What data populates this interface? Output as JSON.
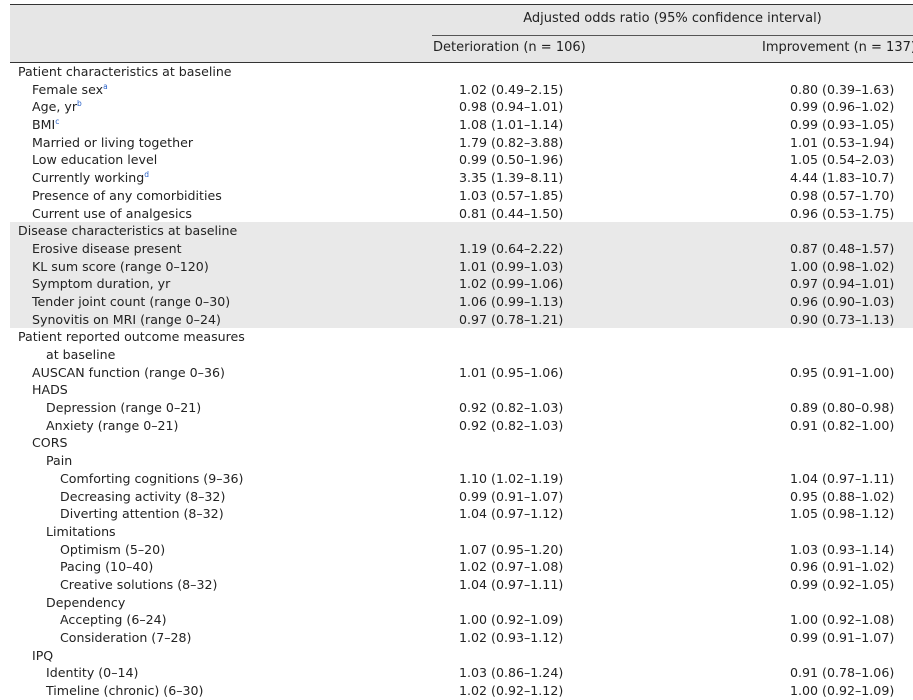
{
  "header": {
    "main": "Adjusted odds ratio (95% confidence interval)",
    "col_deterioration": "Deterioration (n = 106)",
    "col_improvement": "Improvement (n = 137)"
  },
  "rows": [
    {
      "label": "Patient characteristics at baseline",
      "sup": "",
      "d": "",
      "i": "",
      "level": 0,
      "shaded": false
    },
    {
      "label": "Female sex",
      "sup": "a",
      "d": "1.02 (0.49–2.15)",
      "i": "0.80 (0.39–1.63)",
      "level": 1,
      "shaded": false
    },
    {
      "label": "Age, yr",
      "sup": "b",
      "d": "0.98 (0.94–1.01)",
      "i": "0.99 (0.96–1.02)",
      "level": 1,
      "shaded": false
    },
    {
      "label": "BMI",
      "sup": "c",
      "d": "1.08 (1.01–1.14)",
      "i": "0.99 (0.93–1.05)",
      "level": 1,
      "shaded": false
    },
    {
      "label": "Married or living together",
      "sup": "",
      "d": "1.79 (0.82–3.88)",
      "i": "1.01 (0.53–1.94)",
      "level": 1,
      "shaded": false
    },
    {
      "label": "Low education level",
      "sup": "",
      "d": "0.99 (0.50–1.96)",
      "i": "1.05 (0.54–2.03)",
      "level": 1,
      "shaded": false
    },
    {
      "label": "Currently working",
      "sup": "d",
      "d": "3.35 (1.39–8.11)",
      "i": "4.44 (1.83–10.7)",
      "level": 1,
      "shaded": false
    },
    {
      "label": "Presence of any comorbidities",
      "sup": "",
      "d": "1.03 (0.57–1.85)",
      "i": "0.98 (0.57–1.70)",
      "level": 1,
      "shaded": false
    },
    {
      "label": "Current use of analgesics",
      "sup": "",
      "d": "0.81 (0.44–1.50)",
      "i": "0.96 (0.53–1.75)",
      "level": 1,
      "shaded": false
    },
    {
      "label": "Disease characteristics at baseline",
      "sup": "",
      "d": "",
      "i": "",
      "level": 0,
      "shaded": true
    },
    {
      "label": "Erosive disease present",
      "sup": "",
      "d": "1.19 (0.64–2.22)",
      "i": "0.87 (0.48–1.57)",
      "level": 1,
      "shaded": true
    },
    {
      "label": "KL sum score (range 0–120)",
      "sup": "",
      "d": "1.01 (0.99–1.03)",
      "i": "1.00 (0.98–1.02)",
      "level": 1,
      "shaded": true
    },
    {
      "label": "Symptom duration, yr",
      "sup": "",
      "d": "1.02 (0.99–1.06)",
      "i": "0.97 (0.94–1.01)",
      "level": 1,
      "shaded": true
    },
    {
      "label": "Tender joint count (range 0–30)",
      "sup": "",
      "d": "1.06 (0.99–1.13)",
      "i": "0.96 (0.90–1.03)",
      "level": 1,
      "shaded": true
    },
    {
      "label": "Synovitis on MRI (range 0–24)",
      "sup": "",
      "d": "0.97 (0.78–1.21)",
      "i": "0.90 (0.73–1.13)",
      "level": 1,
      "shaded": true
    },
    {
      "label": "Patient reported outcome measures",
      "sup": "",
      "d": "",
      "i": "",
      "level": 0,
      "shaded": false
    },
    {
      "label": "at baseline",
      "sup": "",
      "d": "",
      "i": "",
      "level": 2,
      "shaded": false
    },
    {
      "label": "AUSCAN function (range 0–36)",
      "sup": "",
      "d": "1.01 (0.95–1.06)",
      "i": "0.95 (0.91–1.00)",
      "level": 1,
      "shaded": false
    },
    {
      "label": "HADS",
      "sup": "",
      "d": "",
      "i": "",
      "level": 1,
      "shaded": false
    },
    {
      "label": "Depression (range 0–21)",
      "sup": "",
      "d": "0.92 (0.82–1.03)",
      "i": "0.89 (0.80–0.98)",
      "level": 2,
      "shaded": false
    },
    {
      "label": "Anxiety (range 0–21)",
      "sup": "",
      "d": "0.92 (0.82–1.03)",
      "i": "0.91 (0.82–1.00)",
      "level": 2,
      "shaded": false
    },
    {
      "label": "CORS",
      "sup": "",
      "d": "",
      "i": "",
      "level": 1,
      "shaded": false
    },
    {
      "label": "Pain",
      "sup": "",
      "d": "",
      "i": "",
      "level": 2,
      "shaded": false
    },
    {
      "label": "Comforting cognitions (9–36)",
      "sup": "",
      "d": "1.10 (1.02–1.19)",
      "i": "1.04 (0.97–1.11)",
      "level": 3,
      "shaded": false
    },
    {
      "label": "Decreasing activity (8–32)",
      "sup": "",
      "d": "0.99 (0.91–1.07)",
      "i": "0.95 (0.88–1.02)",
      "level": 3,
      "shaded": false
    },
    {
      "label": "Diverting attention (8–32)",
      "sup": "",
      "d": "1.04 (0.97–1.12)",
      "i": "1.05 (0.98–1.12)",
      "level": 3,
      "shaded": false
    },
    {
      "label": "Limitations",
      "sup": "",
      "d": "",
      "i": "",
      "level": 2,
      "shaded": false
    },
    {
      "label": "Optimism (5–20)",
      "sup": "",
      "d": "1.07 (0.95–1.20)",
      "i": "1.03 (0.93–1.14)",
      "level": 3,
      "shaded": false
    },
    {
      "label": "Pacing (10–40)",
      "sup": "",
      "d": "1.02 (0.97–1.08)",
      "i": "0.96 (0.91–1.02)",
      "level": 3,
      "shaded": false
    },
    {
      "label": "Creative solutions (8–32)",
      "sup": "",
      "d": "1.04 (0.97–1.11)",
      "i": "0.99 (0.92–1.05)",
      "level": 3,
      "shaded": false
    },
    {
      "label": "Dependency",
      "sup": "",
      "d": "",
      "i": "",
      "level": 2,
      "shaded": false
    },
    {
      "label": "Accepting (6–24)",
      "sup": "",
      "d": "1.00 (0.92–1.09)",
      "i": "1.00 (0.92–1.08)",
      "level": 3,
      "shaded": false
    },
    {
      "label": "Consideration (7–28)",
      "sup": "",
      "d": "1.02 (0.93–1.12)",
      "i": "0.99 (0.91–1.07)",
      "level": 3,
      "shaded": false
    },
    {
      "label": "IPQ",
      "sup": "",
      "d": "",
      "i": "",
      "level": 1,
      "shaded": false
    },
    {
      "label": "Identity (0–14)",
      "sup": "",
      "d": "1.03 (0.86–1.24)",
      "i": "0.91 (0.78–1.06)",
      "level": 2,
      "shaded": false
    },
    {
      "label": "Timeline (chronic) (6–30)",
      "sup": "",
      "d": "1.02 (0.92–1.12)",
      "i": "1.00 (0.92–1.09)",
      "level": 2,
      "shaded": false
    }
  ]
}
